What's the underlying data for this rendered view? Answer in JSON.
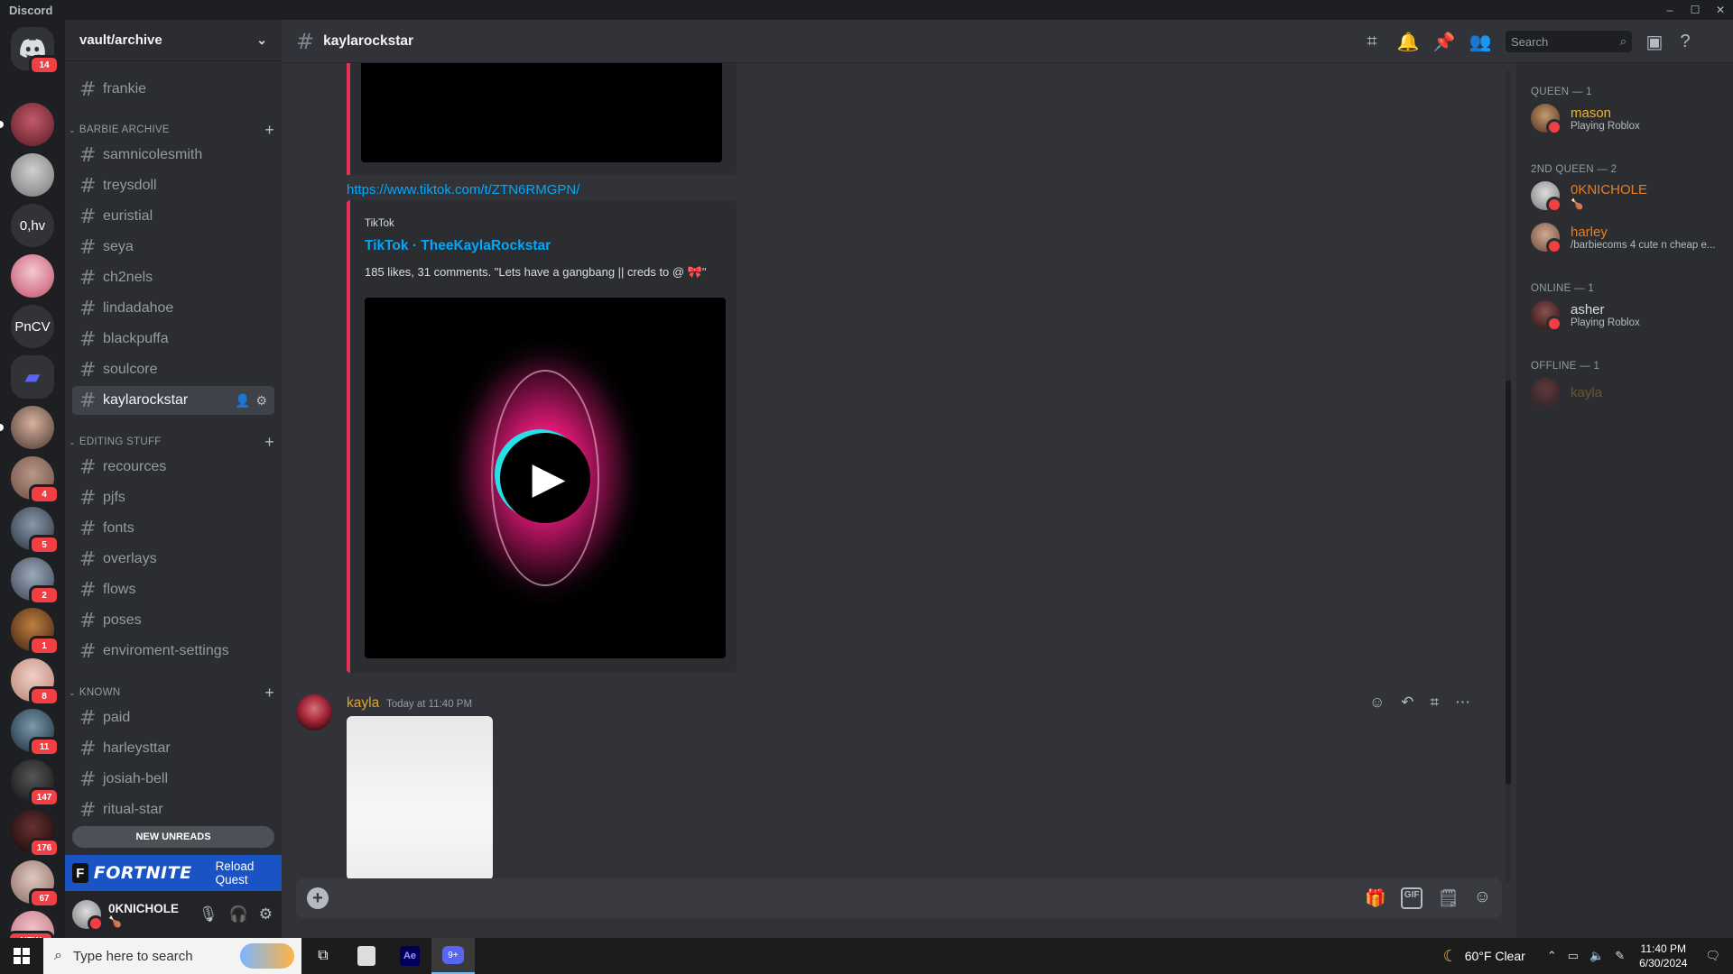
{
  "app": {
    "title": "Discord",
    "window_controls": [
      "–",
      "☐",
      "✕"
    ]
  },
  "colors": {
    "accent": "#5865f2",
    "dnd": "#f23f43",
    "embed_border": "#e32f5a",
    "link": "#00a8fc",
    "author_kayla": "#e3a31b",
    "role_queen": "#f0b232",
    "role_2nd_queen": "#e67e22"
  },
  "servers": [
    {
      "label": "",
      "icon": "discord-logo-icon",
      "badge": "14"
    },
    {
      "label": "",
      "badge": ""
    },
    {
      "label": "",
      "badge": ""
    },
    {
      "label": "0,hv",
      "badge": ""
    },
    {
      "label": "",
      "badge": ""
    },
    {
      "label": "PnCV",
      "badge": ""
    },
    {
      "label": "",
      "icon": "folder-icon",
      "badge": ""
    },
    {
      "label": "",
      "badge": ""
    },
    {
      "label": "",
      "badge": "4"
    },
    {
      "label": "",
      "badge": "5"
    },
    {
      "label": "",
      "badge": "2"
    },
    {
      "label": "",
      "badge": "1"
    },
    {
      "label": "",
      "badge": "8"
    },
    {
      "label": "",
      "badge": "11"
    },
    {
      "label": "",
      "badge": "147"
    },
    {
      "label": "",
      "badge": "176"
    },
    {
      "label": "",
      "badge": "67"
    },
    {
      "label": "",
      "badge": "NEW"
    }
  ],
  "sidebar": {
    "server_name": "vault/archive",
    "top_channel": "frankie",
    "categories": [
      {
        "name": "BARBIE ARCHIVE",
        "channels": [
          "samnicolesmith",
          "treysdoll",
          "euristial",
          "seya",
          "ch2nels",
          "lindadahoe",
          "blackpuffa",
          "soulcore",
          "kaylarockstar"
        ]
      },
      {
        "name": "EDITING STUFF",
        "channels": [
          "recources",
          "pjfs",
          "fonts",
          "overlays",
          "flows",
          "poses",
          "enviroment-settings"
        ]
      },
      {
        "name": "KNOWN",
        "channels": [
          "paid",
          "harleysttar",
          "josiah-bell",
          "ritual-star"
        ]
      }
    ],
    "active_channel": "kaylarockstar",
    "new_unreads": "NEW UNREADS",
    "quest": {
      "game": "FORTNITE",
      "logo_letter": "F",
      "action": "Reload Quest"
    },
    "user": {
      "name": "0KNICHOLE",
      "status_emoji": "🍗"
    }
  },
  "header": {
    "channel": "kaylarockstar",
    "search_placeholder": "Search"
  },
  "messages": {
    "link": "https://www.tiktok.com/t/ZTN6RMGPN/",
    "embed": {
      "provider": "TikTok",
      "title": "TikTok · TheeKaylaRockstar",
      "description": "185 likes, 31 comments. \"Lets have a gangbang || creds to @ 🎀\""
    },
    "next": {
      "author": "kayla",
      "timestamp": "Today at 11:40 PM"
    }
  },
  "members": {
    "groups": [
      {
        "header": "QUEEN — 1",
        "members": [
          {
            "name": "mason",
            "activity": "Playing Roblox",
            "color": "#f0b232"
          }
        ]
      },
      {
        "header": "2ND QUEEN — 2",
        "members": [
          {
            "name": "0KNICHOLE",
            "activity": "🍗",
            "color": "#e67e22"
          },
          {
            "name": "harley",
            "activity": "/barbiecoms 4 cute n cheap e...",
            "color": "#e67e22"
          }
        ]
      },
      {
        "header": "ONLINE — 1",
        "members": [
          {
            "name": "asher",
            "activity": "Playing Roblox",
            "color": "#dbdee1"
          }
        ]
      },
      {
        "header": "OFFLINE — 1",
        "members": [
          {
            "name": "kayla",
            "activity": "",
            "color": "#6d5a2a"
          }
        ]
      }
    ]
  },
  "taskbar": {
    "search_placeholder": "Type here to search",
    "discord_badge": "9+",
    "weather": "60°F  Clear",
    "time": "11:40 PM",
    "date": "6/30/2024"
  }
}
